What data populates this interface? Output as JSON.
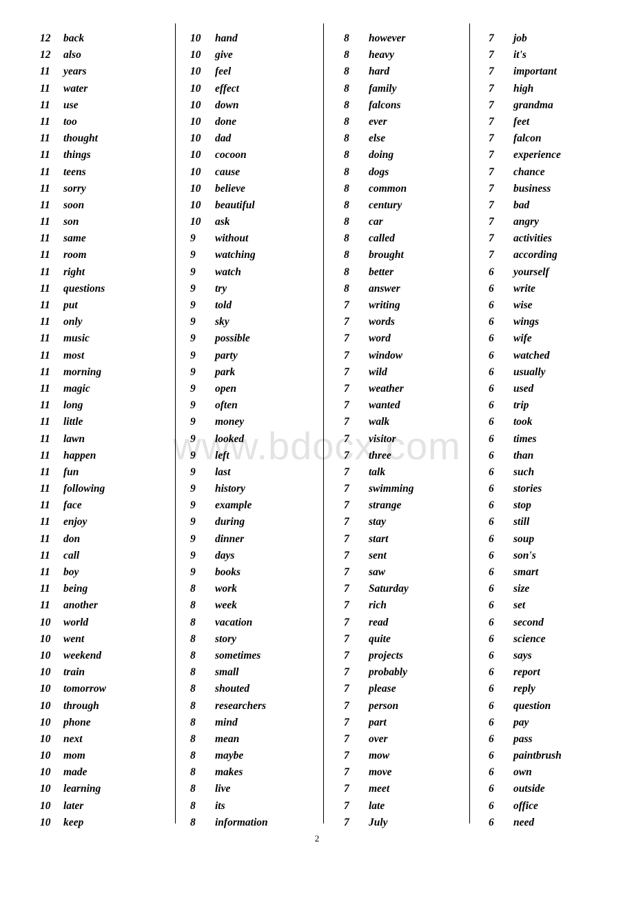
{
  "document": {
    "page_number": "2",
    "watermark": "www.bdocx.com"
  },
  "columns": [
    {
      "entries": [
        {
          "count": "12",
          "word": "back"
        },
        {
          "count": "12",
          "word": "also"
        },
        {
          "count": "11",
          "word": "years"
        },
        {
          "count": "11",
          "word": "water"
        },
        {
          "count": "11",
          "word": "use"
        },
        {
          "count": "11",
          "word": "too"
        },
        {
          "count": "11",
          "word": "thought"
        },
        {
          "count": "11",
          "word": "things"
        },
        {
          "count": "11",
          "word": "teens"
        },
        {
          "count": "11",
          "word": "sorry"
        },
        {
          "count": "11",
          "word": "soon"
        },
        {
          "count": "11",
          "word": "son"
        },
        {
          "count": "11",
          "word": "same"
        },
        {
          "count": "11",
          "word": "room"
        },
        {
          "count": "11",
          "word": "right"
        },
        {
          "count": "11",
          "word": "questions"
        },
        {
          "count": "11",
          "word": "put"
        },
        {
          "count": "11",
          "word": "only"
        },
        {
          "count": "11",
          "word": "music"
        },
        {
          "count": "11",
          "word": "most"
        },
        {
          "count": "11",
          "word": "morning"
        },
        {
          "count": "11",
          "word": "magic"
        },
        {
          "count": "11",
          "word": "long"
        },
        {
          "count": "11",
          "word": "little"
        },
        {
          "count": "11",
          "word": "lawn"
        },
        {
          "count": "11",
          "word": "happen"
        },
        {
          "count": "11",
          "word": "fun"
        },
        {
          "count": "11",
          "word": "following"
        },
        {
          "count": "11",
          "word": "face"
        },
        {
          "count": "11",
          "word": "enjoy"
        },
        {
          "count": "11",
          "word": "don"
        },
        {
          "count": "11",
          "word": "call"
        },
        {
          "count": "11",
          "word": "boy"
        },
        {
          "count": "11",
          "word": "being"
        },
        {
          "count": "11",
          "word": "another"
        },
        {
          "count": "10",
          "word": "world"
        },
        {
          "count": "10",
          "word": "went"
        },
        {
          "count": "10",
          "word": "weekend"
        },
        {
          "count": "10",
          "word": "train"
        },
        {
          "count": "10",
          "word": "tomorrow"
        },
        {
          "count": "10",
          "word": "through"
        },
        {
          "count": "10",
          "word": "phone"
        },
        {
          "count": "10",
          "word": "next"
        },
        {
          "count": "10",
          "word": "mom"
        },
        {
          "count": "10",
          "word": "made"
        },
        {
          "count": "10",
          "word": "learning"
        },
        {
          "count": "10",
          "word": "later"
        },
        {
          "count": "10",
          "word": "keep"
        }
      ]
    },
    {
      "entries": [
        {
          "count": "10",
          "word": "hand"
        },
        {
          "count": "10",
          "word": "give"
        },
        {
          "count": "10",
          "word": "feel"
        },
        {
          "count": "10",
          "word": "effect"
        },
        {
          "count": "10",
          "word": "down"
        },
        {
          "count": "10",
          "word": "done"
        },
        {
          "count": "10",
          "word": "dad"
        },
        {
          "count": "10",
          "word": "cocoon"
        },
        {
          "count": "10",
          "word": "cause"
        },
        {
          "count": "10",
          "word": "believe"
        },
        {
          "count": "10",
          "word": "beautiful"
        },
        {
          "count": "10",
          "word": "ask"
        },
        {
          "count": "9",
          "word": "without"
        },
        {
          "count": "9",
          "word": "watching"
        },
        {
          "count": "9",
          "word": "watch"
        },
        {
          "count": "9",
          "word": "try"
        },
        {
          "count": "9",
          "word": "told"
        },
        {
          "count": "9",
          "word": "sky"
        },
        {
          "count": "9",
          "word": "possible"
        },
        {
          "count": "9",
          "word": "party"
        },
        {
          "count": "9",
          "word": "park"
        },
        {
          "count": "9",
          "word": "open"
        },
        {
          "count": "9",
          "word": "often"
        },
        {
          "count": "9",
          "word": "money"
        },
        {
          "count": "9",
          "word": "looked"
        },
        {
          "count": "9",
          "word": "left"
        },
        {
          "count": "9",
          "word": "last"
        },
        {
          "count": "9",
          "word": "history"
        },
        {
          "count": "9",
          "word": "example"
        },
        {
          "count": "9",
          "word": "during"
        },
        {
          "count": "9",
          "word": "dinner"
        },
        {
          "count": "9",
          "word": "days"
        },
        {
          "count": "9",
          "word": "books"
        },
        {
          "count": "8",
          "word": "work"
        },
        {
          "count": "8",
          "word": "week"
        },
        {
          "count": "8",
          "word": "vacation"
        },
        {
          "count": "8",
          "word": "story"
        },
        {
          "count": "8",
          "word": "sometimes"
        },
        {
          "count": "8",
          "word": "small"
        },
        {
          "count": "8",
          "word": "shouted"
        },
        {
          "count": "8",
          "word": "researchers"
        },
        {
          "count": "8",
          "word": "mind"
        },
        {
          "count": "8",
          "word": "mean"
        },
        {
          "count": "8",
          "word": "maybe"
        },
        {
          "count": "8",
          "word": "makes"
        },
        {
          "count": "8",
          "word": "live"
        },
        {
          "count": "8",
          "word": "its"
        },
        {
          "count": "8",
          "word": "information"
        }
      ]
    },
    {
      "entries": [
        {
          "count": "8",
          "word": "however"
        },
        {
          "count": "8",
          "word": "heavy"
        },
        {
          "count": "8",
          "word": "hard"
        },
        {
          "count": "8",
          "word": "family"
        },
        {
          "count": "8",
          "word": "falcons"
        },
        {
          "count": "8",
          "word": "ever"
        },
        {
          "count": "8",
          "word": "else"
        },
        {
          "count": "8",
          "word": "doing"
        },
        {
          "count": "8",
          "word": "dogs"
        },
        {
          "count": "8",
          "word": "common"
        },
        {
          "count": "8",
          "word": "century"
        },
        {
          "count": "8",
          "word": "car"
        },
        {
          "count": "8",
          "word": "called"
        },
        {
          "count": "8",
          "word": "brought"
        },
        {
          "count": "8",
          "word": "better"
        },
        {
          "count": "8",
          "word": "answer"
        },
        {
          "count": "7",
          "word": "writing"
        },
        {
          "count": "7",
          "word": "words"
        },
        {
          "count": "7",
          "word": "word"
        },
        {
          "count": "7",
          "word": "window"
        },
        {
          "count": "7",
          "word": "wild"
        },
        {
          "count": "7",
          "word": "weather"
        },
        {
          "count": "7",
          "word": "wanted"
        },
        {
          "count": "7",
          "word": "walk"
        },
        {
          "count": "7",
          "word": "visitor"
        },
        {
          "count": "7",
          "word": "three"
        },
        {
          "count": "7",
          "word": "talk"
        },
        {
          "count": "7",
          "word": "swimming"
        },
        {
          "count": "7",
          "word": "strange"
        },
        {
          "count": "7",
          "word": "stay"
        },
        {
          "count": "7",
          "word": "start"
        },
        {
          "count": "7",
          "word": "sent"
        },
        {
          "count": "7",
          "word": "saw"
        },
        {
          "count": "7",
          "word": "Saturday"
        },
        {
          "count": "7",
          "word": "rich"
        },
        {
          "count": "7",
          "word": "read"
        },
        {
          "count": "7",
          "word": "quite"
        },
        {
          "count": "7",
          "word": "projects"
        },
        {
          "count": "7",
          "word": "probably"
        },
        {
          "count": "7",
          "word": "please"
        },
        {
          "count": "7",
          "word": "person"
        },
        {
          "count": "7",
          "word": "part"
        },
        {
          "count": "7",
          "word": "over"
        },
        {
          "count": "7",
          "word": "mow"
        },
        {
          "count": "7",
          "word": "move"
        },
        {
          "count": "7",
          "word": "meet"
        },
        {
          "count": "7",
          "word": "late"
        },
        {
          "count": "7",
          "word": "July"
        }
      ]
    },
    {
      "entries": [
        {
          "count": "7",
          "word": "job"
        },
        {
          "count": "7",
          "word": "it's"
        },
        {
          "count": "7",
          "word": "important"
        },
        {
          "count": "7",
          "word": "high"
        },
        {
          "count": "7",
          "word": "grandma"
        },
        {
          "count": "7",
          "word": "feet"
        },
        {
          "count": "7",
          "word": "falcon"
        },
        {
          "count": "7",
          "word": "experience"
        },
        {
          "count": "7",
          "word": "chance"
        },
        {
          "count": "7",
          "word": "business"
        },
        {
          "count": "7",
          "word": "bad"
        },
        {
          "count": "7",
          "word": "angry"
        },
        {
          "count": "7",
          "word": "activities"
        },
        {
          "count": "7",
          "word": "according"
        },
        {
          "count": "6",
          "word": "yourself"
        },
        {
          "count": "6",
          "word": "write"
        },
        {
          "count": "6",
          "word": "wise"
        },
        {
          "count": "6",
          "word": "wings"
        },
        {
          "count": "6",
          "word": "wife"
        },
        {
          "count": "6",
          "word": "watched"
        },
        {
          "count": "6",
          "word": "usually"
        },
        {
          "count": "6",
          "word": "used"
        },
        {
          "count": "6",
          "word": "trip"
        },
        {
          "count": "6",
          "word": "took"
        },
        {
          "count": "6",
          "word": "times"
        },
        {
          "count": "6",
          "word": "than"
        },
        {
          "count": "6",
          "word": "such"
        },
        {
          "count": "6",
          "word": "stories"
        },
        {
          "count": "6",
          "word": "stop"
        },
        {
          "count": "6",
          "word": "still"
        },
        {
          "count": "6",
          "word": "soup"
        },
        {
          "count": "6",
          "word": "son's"
        },
        {
          "count": "6",
          "word": "smart"
        },
        {
          "count": "6",
          "word": "size"
        },
        {
          "count": "6",
          "word": "set"
        },
        {
          "count": "6",
          "word": "second"
        },
        {
          "count": "6",
          "word": "science"
        },
        {
          "count": "6",
          "word": "says"
        },
        {
          "count": "6",
          "word": "report"
        },
        {
          "count": "6",
          "word": "reply"
        },
        {
          "count": "6",
          "word": "question"
        },
        {
          "count": "6",
          "word": "pay"
        },
        {
          "count": "6",
          "word": "pass"
        },
        {
          "count": "6",
          "word": "paintbrush"
        },
        {
          "count": "6",
          "word": "own"
        },
        {
          "count": "6",
          "word": "outside"
        },
        {
          "count": "6",
          "word": "office"
        },
        {
          "count": "6",
          "word": "need"
        }
      ]
    }
  ]
}
